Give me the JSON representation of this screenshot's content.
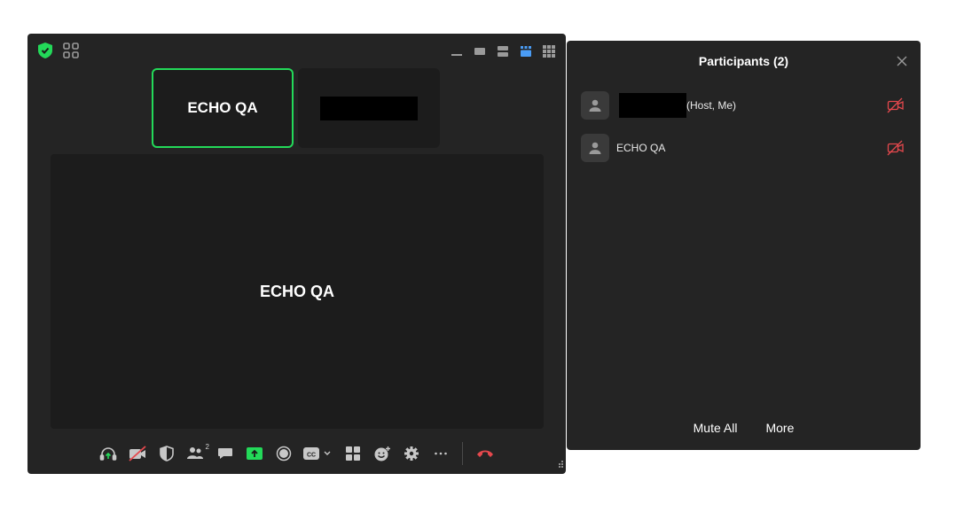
{
  "meeting": {
    "thumbnails": [
      {
        "name": "ECHO QA",
        "active": true
      },
      {
        "name": "",
        "redacted": true
      }
    ],
    "main_speaker": "ECHO QA",
    "toolbar": {
      "participants_count": "2",
      "icons": [
        "audio-icon",
        "video-off-icon",
        "security-icon",
        "participants-icon",
        "chat-icon",
        "share-screen-icon",
        "record-icon",
        "captions-icon",
        "apps-icon",
        "reactions-icon",
        "settings-icon",
        "more-icon",
        "leave-icon"
      ]
    },
    "colors": {
      "active_border": "#23d959",
      "share": "#23d959",
      "leave": "#e5484d",
      "selected_view": "#4a9cf5"
    }
  },
  "participants_panel": {
    "title": "Participants (2)",
    "participants": [
      {
        "name": "",
        "tag": "(Host, Me)",
        "redacted": true
      },
      {
        "name": "ECHO QA",
        "tag": ""
      }
    ],
    "mute_all": "Mute All",
    "more": "More"
  }
}
